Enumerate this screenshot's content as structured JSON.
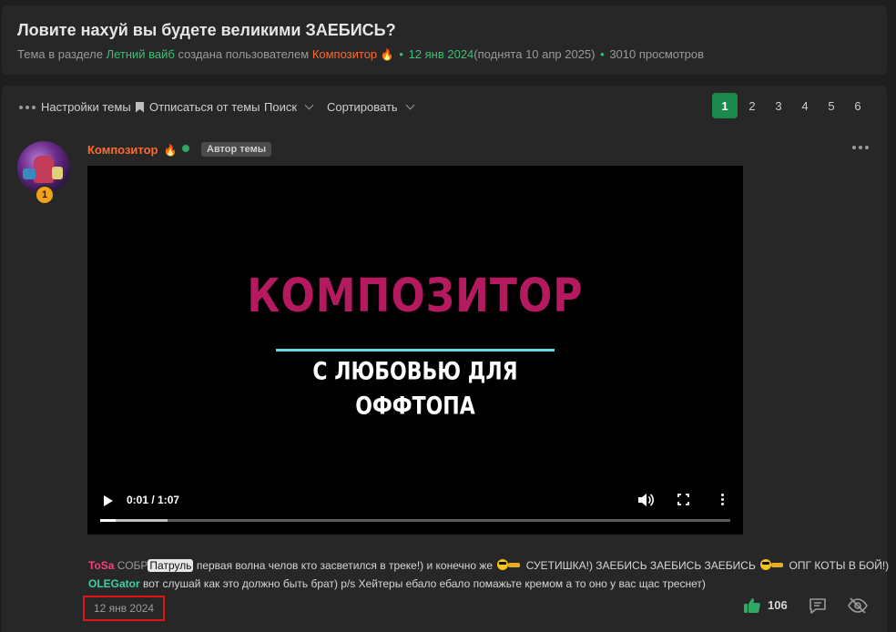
{
  "topic": {
    "title": "Ловите нахуй вы будете великими ЗАЕБИСЬ?",
    "meta_prefix": "Тема в разделе",
    "section": "Летний вайб",
    "meta_mid": "создана пользователем",
    "author": "Композитор",
    "created": "12 янв 2024",
    "raised": "(поднята 10 апр 2025)",
    "views": "3010 просмотров"
  },
  "toolbar": {
    "settings": "Настройки темы",
    "unsubscribe": "Отписаться от темы",
    "search": "Поиск",
    "sort": "Сортировать"
  },
  "pagination": {
    "pages": [
      "1",
      "2",
      "3",
      "4",
      "5",
      "6"
    ],
    "current": "1"
  },
  "post": {
    "author": "Композитор",
    "author_tag": "Автор темы",
    "badge": "1",
    "video": {
      "title": "КОМПОЗИТОР",
      "subtitle_line1": "С ЛЮБОВЬЮ ДЛЯ",
      "subtitle_line2": "ОФФТОПА",
      "time": "0:01 / 1:07",
      "progress": 0.025,
      "buffered": 0.107
    },
    "comments": [
      {
        "user": "ToSa",
        "pre": "СОБР",
        "highlight": "Патруль",
        "text": "первая волна челов кто засветился в треке!) и конечно же",
        "text2": "СУЕТИШКА!) ЗАЕБИСЬ ЗАЕБИСЬ ЗАЕБИСЬ",
        "text3": "ОПГ КОТЫ В БОЙ!)"
      },
      {
        "user": "OLEGator",
        "text": "вот слушай как это должно быть брат) p/s Хейтеры ебало ебало помажьте кремом а то оно у вас щас треснет)"
      }
    ],
    "date": "12 янв 2024",
    "likes": "106"
  },
  "colors": {
    "accent_green": "#1d8a4d",
    "author_orange": "#ff6a2b",
    "video_title": "#b5195f",
    "video_line": "#67d8e6",
    "date_outline": "#e01414"
  }
}
